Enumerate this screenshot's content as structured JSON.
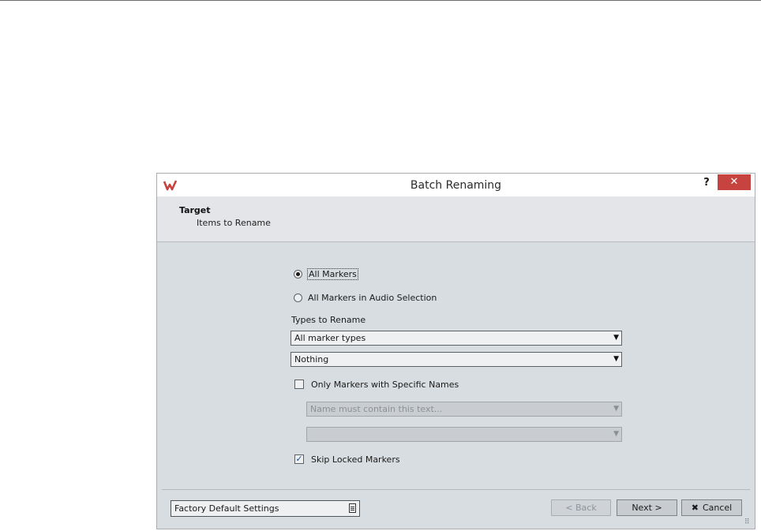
{
  "dialog": {
    "title": "Batch Renaming",
    "help_label": "?",
    "close_glyph": "✕",
    "logo_icon": "wavelab-logo-icon",
    "accent_color": "#c7433f"
  },
  "header": {
    "title": "Target",
    "subtitle": "Items to Rename"
  },
  "scope": {
    "all_markers_label": "All Markers",
    "all_markers_selected": true,
    "all_markers_in_selection_label": "All Markers in Audio Selection",
    "all_markers_in_selection_selected": false
  },
  "types": {
    "label": "Types to Rename",
    "primary_value": "All marker types",
    "secondary_value": "Nothing",
    "arrow": "▼"
  },
  "names_filter": {
    "checkbox_label": "Only Markers with Specific Names",
    "checked": false,
    "contain_placeholder": "Name must contain this text...",
    "second_value": "",
    "arrow": "▼"
  },
  "skip_locked": {
    "label": "Skip Locked Markers",
    "checked": true,
    "check_glyph": "✓"
  },
  "footer": {
    "preset_value": "Factory Default Settings",
    "back_label": "< Back",
    "next_label": "Next >",
    "cancel_label": "Cancel",
    "cancel_glyph": "✖",
    "grip_glyph": "⠿"
  }
}
